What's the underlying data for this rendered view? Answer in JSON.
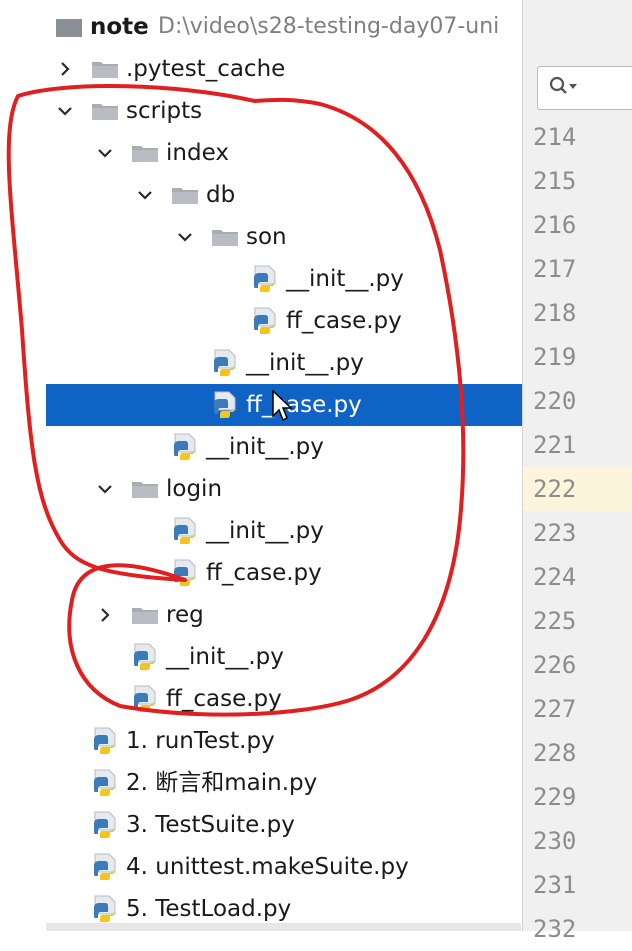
{
  "project": {
    "name": "note",
    "path": "D:\\video\\s28-testing-day07-uni"
  },
  "tree": [
    {
      "label": ".pytest_cache",
      "type": "folder",
      "depth": 1,
      "state": "collapsed"
    },
    {
      "label": "scripts",
      "type": "folder",
      "depth": 1,
      "state": "expanded"
    },
    {
      "label": "index",
      "type": "folder",
      "depth": 2,
      "state": "expanded"
    },
    {
      "label": "db",
      "type": "folder",
      "depth": 3,
      "state": "expanded"
    },
    {
      "label": "son",
      "type": "folder",
      "depth": 4,
      "state": "expanded"
    },
    {
      "label": "__init__.py",
      "type": "python",
      "depth": 5
    },
    {
      "label": "ff_case.py",
      "type": "python",
      "depth": 5
    },
    {
      "label": "__init__.py",
      "type": "python",
      "depth": 4
    },
    {
      "label": "ff_case.py",
      "type": "python",
      "depth": 4,
      "selected": true
    },
    {
      "label": "__init__.py",
      "type": "python",
      "depth": 3
    },
    {
      "label": "login",
      "type": "folder",
      "depth": 2,
      "state": "expanded"
    },
    {
      "label": "__init__.py",
      "type": "python",
      "depth": 3
    },
    {
      "label": "ff_case.py",
      "type": "python",
      "depth": 3
    },
    {
      "label": "reg",
      "type": "folder",
      "depth": 2,
      "state": "collapsed"
    },
    {
      "label": "__init__.py",
      "type": "python",
      "depth": 2
    },
    {
      "label": "ff_case.py",
      "type": "python",
      "depth": 2
    },
    {
      "label": "1. runTest.py",
      "type": "python",
      "depth": 1
    },
    {
      "label": "2. 断言和main.py",
      "type": "python",
      "depth": 1
    },
    {
      "label": "3. TestSuite.py",
      "type": "python",
      "depth": 1
    },
    {
      "label": "4. unittest.makeSuite.py",
      "type": "python",
      "depth": 1
    },
    {
      "label": "5. TestLoad.py",
      "type": "python",
      "depth": 1
    }
  ],
  "line_numbers": [
    "214",
    "215",
    "216",
    "217",
    "218",
    "219",
    "220",
    "221",
    "222",
    "223",
    "224",
    "225",
    "226",
    "227",
    "228",
    "229",
    "230",
    "231",
    "232"
  ],
  "current_line": "222",
  "colors": {
    "selection": "#0e63c5",
    "annotation": "#e02020",
    "current_line_bg": "#fcf5dc",
    "folder": "#a9adb3",
    "python_blue": "#3d7ab8",
    "python_yellow": "#f5c518"
  },
  "icons": {
    "search": "search-icon",
    "folder": "folder-icon",
    "python": "python-file-icon",
    "expanded": "chevron-down-icon",
    "collapsed": "chevron-right-icon"
  }
}
